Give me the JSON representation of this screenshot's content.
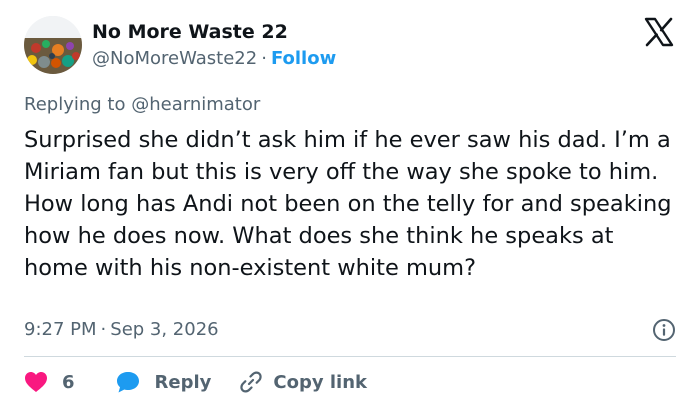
{
  "author": {
    "name": "No More Waste 22",
    "handle": "@NoMoreWaste22",
    "separator": "·",
    "follow_label": "Follow"
  },
  "reply_context": {
    "prefix": "Replying to",
    "mention": "@hearnimator"
  },
  "tweet": {
    "text": "Surprised she didn’t ask him if he ever saw his dad. I’m a Miriam fan but this is very off the way she spoke to him. How long has Andi not been on the telly for and speaking how he does now. What does she think he speaks at home with his non-existent white mum?"
  },
  "meta": {
    "time": "9:27 PM",
    "separator": "·",
    "date": "Sep 3, 2026"
  },
  "actions": {
    "like_count": "6",
    "reply_label": "Reply",
    "copy_link_label": "Copy link"
  },
  "icons": {
    "logo": "x-logo-icon",
    "info": "info-icon",
    "like": "heart-icon",
    "reply": "reply-bubble-icon",
    "copy_link": "link-icon"
  },
  "colors": {
    "accent": "#1d9bf0",
    "like": "#f91880",
    "text": "#0f1419",
    "muted": "#536471",
    "divider": "#cfd9de"
  }
}
